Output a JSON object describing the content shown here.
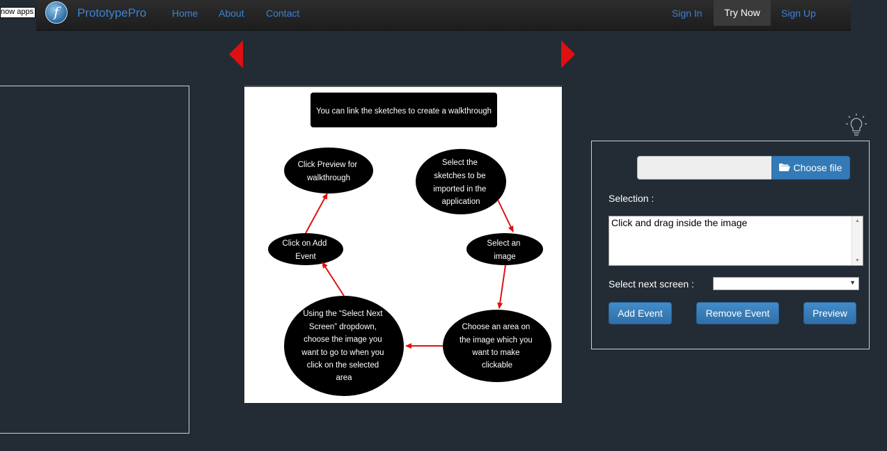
{
  "topbar": {
    "show_apps": "now apps"
  },
  "nav": {
    "logo_letter": "f",
    "brand": "PrototypePro",
    "links": [
      "Home",
      "About",
      "Contact"
    ],
    "sign_in": "Sign In",
    "try_now": "Try Now",
    "sign_up": "Sign Up"
  },
  "colors": {
    "background": "#232b35",
    "link": "#3d82d6",
    "arrow": "#e01010",
    "button": "#337ab7"
  },
  "diagram": {
    "header": "You can link the sketches to create a walkthrough",
    "steps": {
      "select_sketches": [
        "Select the",
        "sketches to be",
        "imported in the",
        "application"
      ],
      "select_image": [
        "Select an",
        "image"
      ],
      "choose_area": [
        "Choose an area on",
        "the image which you",
        "want to make",
        "clickable"
      ],
      "select_next": [
        "Using the “Select Next",
        "Screen” dropdown,",
        "choose the image you",
        "want to go to when you",
        "click on the selected",
        "area"
      ],
      "add_event": [
        "Click on Add",
        "Event"
      ],
      "preview": [
        "Click Preview for",
        "walkthrough"
      ]
    }
  },
  "panel": {
    "choose_file": "Choose file",
    "selection_label": "Selection :",
    "selection_text": "Click and drag inside the image",
    "next_screen_label": "Select next screen :",
    "next_screen_value": "",
    "add_event": "Add Event",
    "remove_event": "Remove Event",
    "preview": "Preview"
  }
}
